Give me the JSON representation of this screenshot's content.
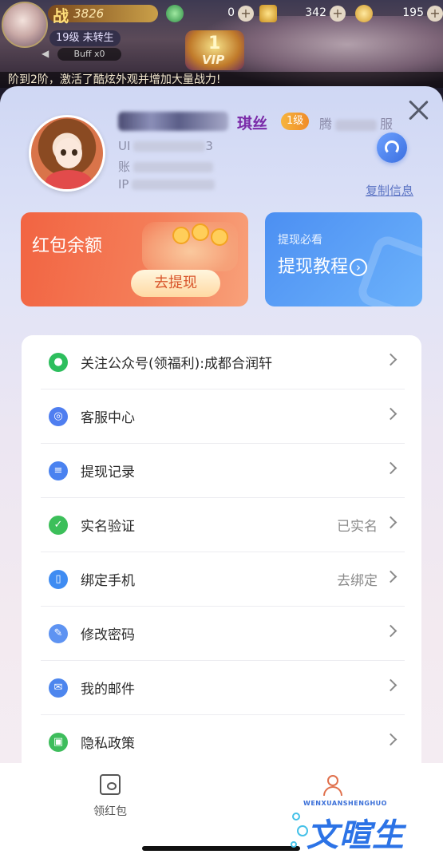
{
  "game": {
    "power_label": "战",
    "power_value": "3826",
    "resource1": "0",
    "resource2": "342",
    "resource3": "195",
    "level_status": "19级  未转生",
    "buff_label": "Buff x0",
    "vip_level": "1",
    "vip_label": "VIP",
    "marquee": "阶到2阶，激活了酷炫外观并增加大量战力!"
  },
  "profile": {
    "nickname": "琪丝",
    "level_badge": "1级",
    "server_prefix": "腾",
    "server_suffix": "服",
    "uid_label": "UI",
    "uid_tail": "3",
    "account_label": "账",
    "ip_label": "IP",
    "copy_info": "复制信息"
  },
  "cards": {
    "redpacket_title": "红包余额",
    "withdraw_button": "去提现",
    "tutorial_sub": "提现必看",
    "tutorial_title": "提现教程",
    "tutorial_arrow": "›"
  },
  "menu": [
    {
      "label": "关注公众号(领福利):成都合润轩",
      "value": "",
      "icon": "wechat-icon",
      "color": "#2dbe5d"
    },
    {
      "label": "客服中心",
      "value": "",
      "icon": "headset-icon",
      "color": "#4f7ef0"
    },
    {
      "label": "提现记录",
      "value": "",
      "icon": "record-icon",
      "color": "#4a82f0"
    },
    {
      "label": "实名验证",
      "value": "已实名",
      "icon": "verified-icon",
      "color": "#3cbf5a"
    },
    {
      "label": "绑定手机",
      "value": "去绑定",
      "icon": "phone-icon",
      "color": "#3f8cf2"
    },
    {
      "label": "修改密码",
      "value": "",
      "icon": "edit-password-icon",
      "color": "#5e93f2"
    },
    {
      "label": "我的邮件",
      "value": "",
      "icon": "mail-icon",
      "color": "#4d86ee"
    },
    {
      "label": "隐私政策",
      "value": "",
      "icon": "privacy-icon",
      "color": "#3ebd5c"
    }
  ],
  "tabs": {
    "redpacket": "领红包"
  },
  "watermark": {
    "small": "WENXUANSHENGHUO",
    "big": "文暄生活"
  },
  "colors": {
    "accent_orange": "#f26442",
    "accent_blue": "#4c8ff2",
    "nickname_purple": "#7a2aa8",
    "level_badge": "#f6b43d"
  }
}
